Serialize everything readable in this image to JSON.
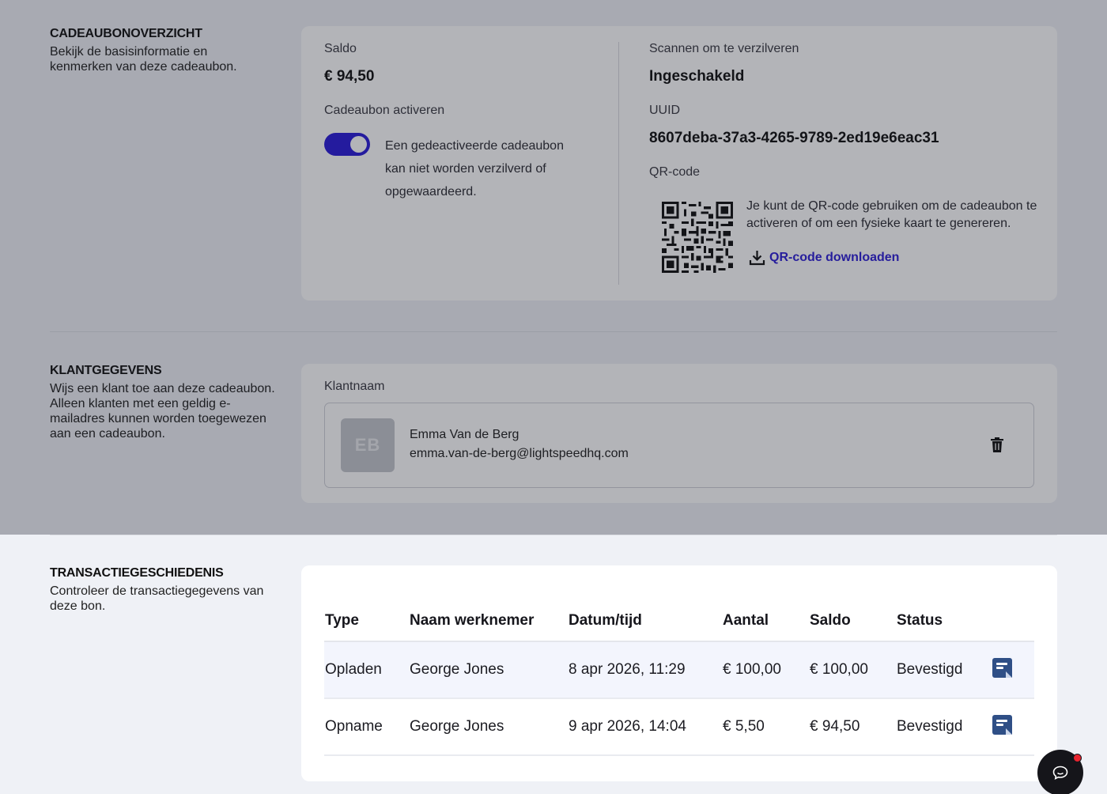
{
  "overview": {
    "title": "CADEAUBONOVERZICHT",
    "description": "Bekijk de basisinformatie en kenmerken van deze cadeaubon.",
    "balance_label": "Saldo",
    "balance_value": "€ 94,50",
    "activate_label": "Cadeaubon activeren",
    "activate_enabled": true,
    "activate_help": "Een gedeactiveerde cadeaubon kan niet worden verzilverd of opgewaardeerd.",
    "scan_label": "Scannen om te verzilveren",
    "scan_value": "Ingeschakeld",
    "uuid_label": "UUID",
    "uuid_value": "8607deba-37a3-4265-9789-2ed19e6eac31",
    "qr_label": "QR-code",
    "qr_help": "Je kunt de QR-code gebruiken om de cadeaubon te activeren of om een fysieke kaart te genereren.",
    "qr_download_label": "QR-code downloaden",
    "download_icon": "download-icon"
  },
  "customer": {
    "title": "KLANTGEGEVENS",
    "description": "Wijs een klant toe aan deze cadeaubon. Alleen klanten met een geldig e-mailadres kunnen worden toegewezen aan een cadeaubon.",
    "name_label": "Klantnaam",
    "initials": "EB",
    "name": "Emma Van de Berg",
    "email": "emma.van-de-berg@lightspeedhq.com",
    "delete_icon": "trash-icon"
  },
  "transactions": {
    "title": "TRANSACTIEGESCHIEDENIS",
    "description": "Controleer de transactiegegevens van deze bon.",
    "columns": [
      "Type",
      "Naam werknemer",
      "Datum/tijd",
      "Aantal",
      "Saldo",
      "Status"
    ],
    "rows": [
      {
        "type": "Opladen",
        "employee": "George Jones",
        "datetime": "8 apr 2026, 11:29",
        "amount": "€ 100,00",
        "balance": "€ 100,00",
        "status": "Bevestigd"
      },
      {
        "type": "Opname",
        "employee": "George Jones",
        "datetime": "9 apr 2026, 14:04",
        "amount": "€ 5,50",
        "balance": "€ 94,50",
        "status": "Bevestigd"
      }
    ],
    "row_icon": "receipt-icon"
  },
  "colors": {
    "accent": "#2b1bd8",
    "link": "#2d1fd6",
    "overlay": "rgba(24,26,40,0.33)",
    "notification": "#e8242f"
  },
  "chat_icon": "chat-icon"
}
